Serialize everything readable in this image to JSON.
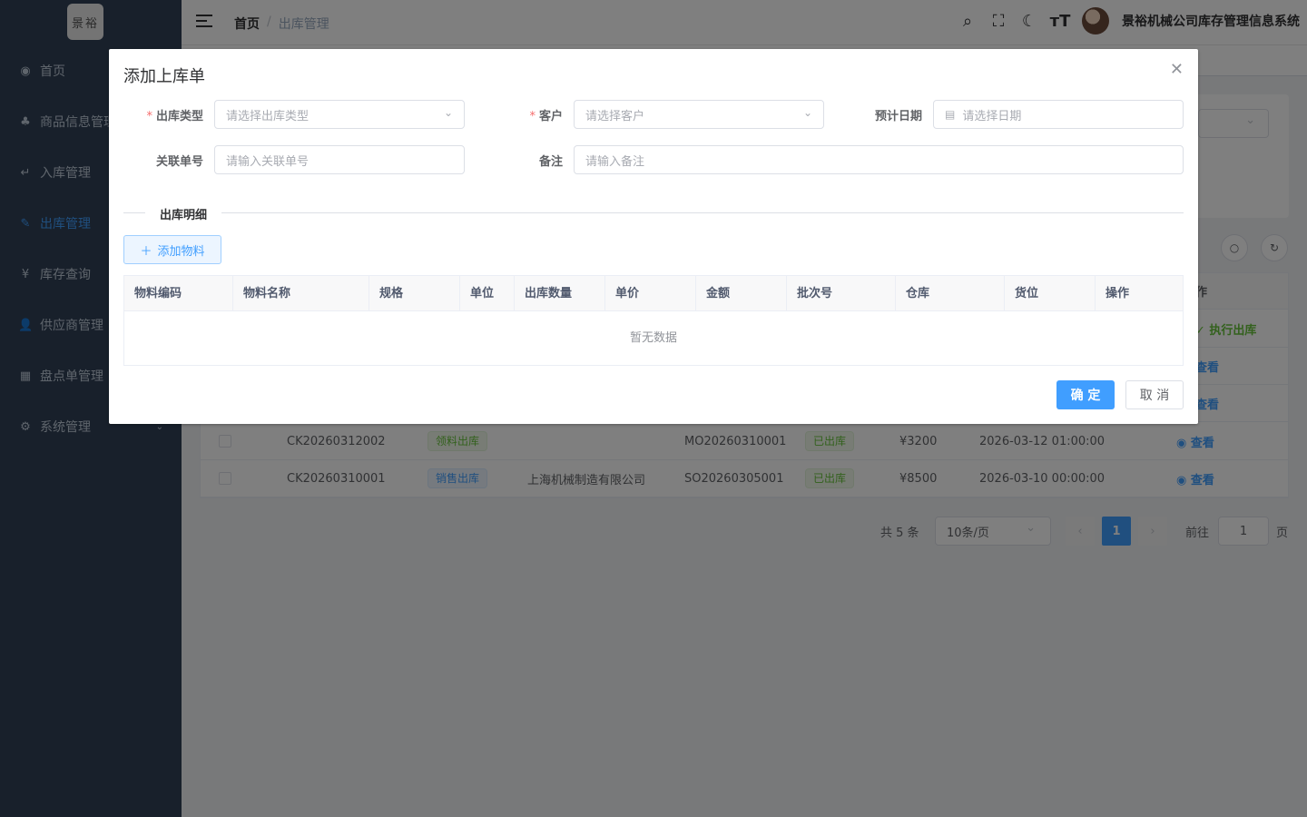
{
  "sidebar": {
    "logo": "景裕",
    "items": [
      {
        "label": "首页",
        "icon": "dashboard-icon",
        "glyph": "◉"
      },
      {
        "label": "商品信息管理",
        "icon": "tree-icon",
        "glyph": "♣"
      },
      {
        "label": "入库管理",
        "icon": "enter-icon",
        "glyph": "↵"
      },
      {
        "label": "出库管理",
        "icon": "edit-icon",
        "glyph": "✎"
      },
      {
        "label": "库存查询",
        "icon": "yen-icon",
        "glyph": "¥"
      },
      {
        "label": "供应商管理",
        "icon": "user-icon",
        "glyph": "👤"
      },
      {
        "label": "盘点单管理",
        "icon": "table-icon",
        "glyph": "▦"
      },
      {
        "label": "系统管理",
        "icon": "gear-icon",
        "glyph": "⚙"
      }
    ]
  },
  "header": {
    "breadcrumb_home": "首页",
    "breadcrumb_sep": "/",
    "breadcrumb_current": "出库管理",
    "system_title": "景裕机械公司库存管理信息系统"
  },
  "background_table": {
    "rows": [
      {
        "code": "CK20260312002",
        "type": "领料出库",
        "customer": "",
        "related": "MO20260310001",
        "status": "已出库",
        "amount": "¥3200",
        "date": "2026-03-12 01:00:00",
        "action": "查看"
      },
      {
        "code": "CK20260310001",
        "type": "销售出库",
        "customer": "上海机械制造有限公司",
        "related": "SO20260305001",
        "status": "已出库",
        "amount": "¥8500",
        "date": "2026-03-10 00:00:00",
        "action": "查看"
      }
    ],
    "partial_action_header": "作",
    "partial_exec": "执行出库",
    "partial_view": "查看"
  },
  "pagination": {
    "total": "共 5 条",
    "page_size": "10条/页",
    "current_page": "1",
    "goto_label": "前往",
    "goto_value": "1",
    "page_suffix": "页"
  },
  "dialog": {
    "title": "添加上库单",
    "fields": {
      "out_type_label": "出库类型",
      "out_type_placeholder": "请选择出库类型",
      "customer_label": "客户",
      "customer_placeholder": "请选择客户",
      "date_label": "预计日期",
      "date_placeholder": "请选择日期",
      "related_label": "关联单号",
      "related_placeholder": "请输入关联单号",
      "remark_label": "备注",
      "remark_placeholder": "请输入备注"
    },
    "section_title": "出库明细",
    "add_button": "添加物料",
    "table_headers": [
      "物料编码",
      "物料名称",
      "规格",
      "单位",
      "出库数量",
      "单价",
      "金额",
      "批次号",
      "仓库",
      "货位",
      "操作"
    ],
    "empty_text": "暂无数据",
    "confirm_label": "确 定",
    "cancel_label": "取 消"
  }
}
